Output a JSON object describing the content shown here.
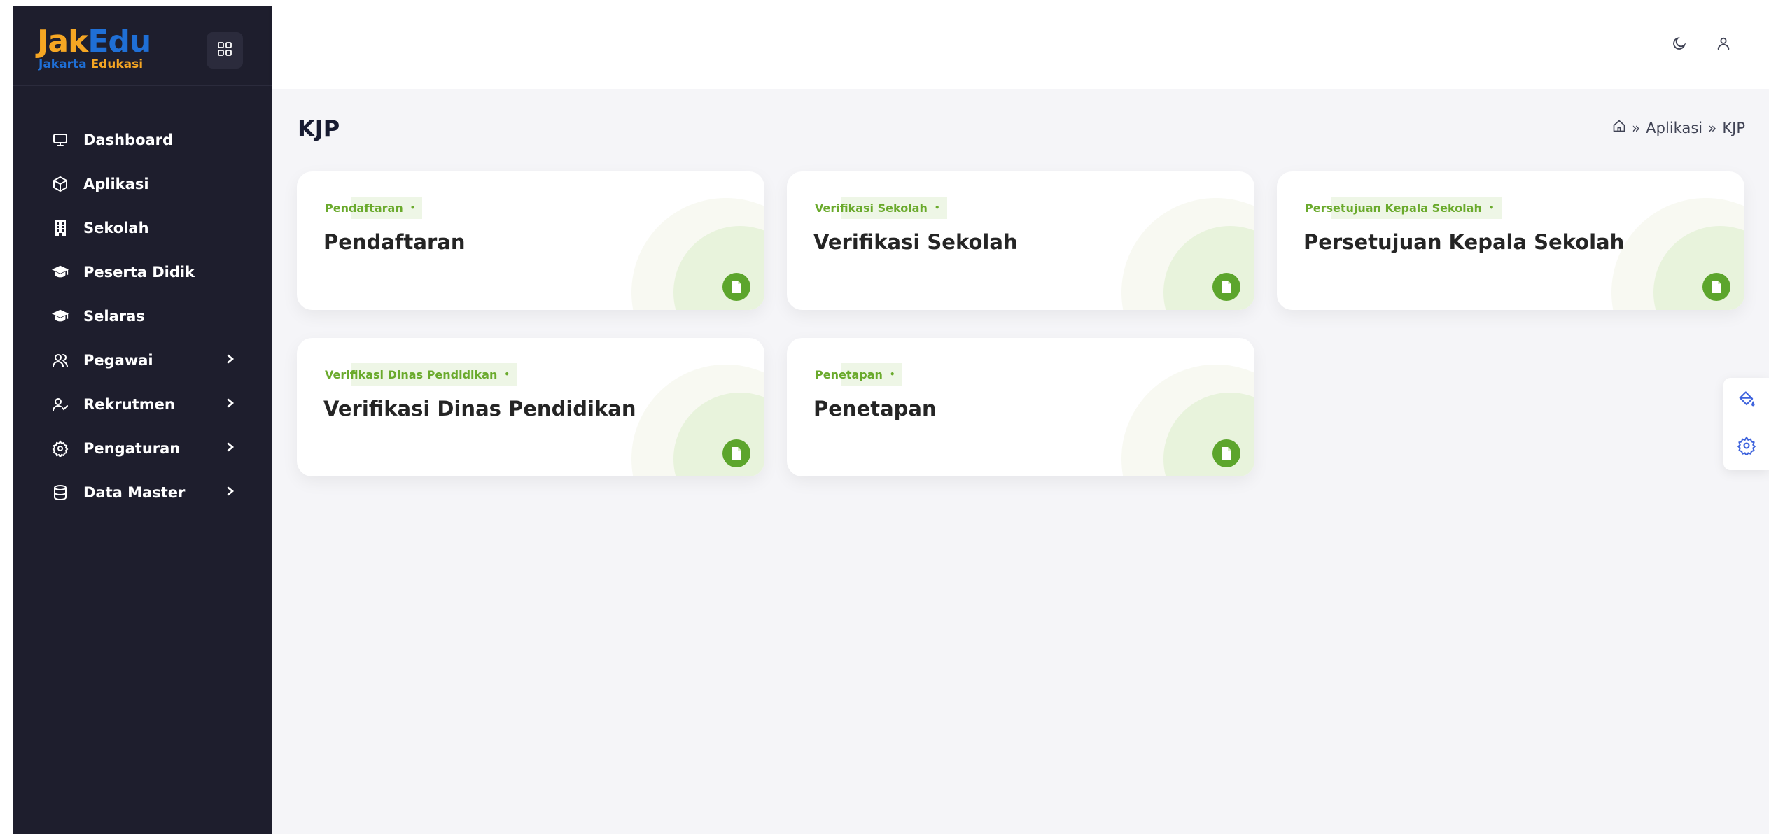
{
  "app": {
    "logo_text": "JakEdu",
    "logo_subtitle_a": "Jakarta",
    "logo_subtitle_b": "Edukasi"
  },
  "sidebar": {
    "items": [
      {
        "label": "Dashboard",
        "icon": "monitor-icon",
        "has_submenu": false
      },
      {
        "label": "Aplikasi",
        "icon": "cube-icon",
        "has_submenu": false
      },
      {
        "label": "Sekolah",
        "icon": "building-icon",
        "has_submenu": false
      },
      {
        "label": "Peserta Didik",
        "icon": "graduation-cap-icon",
        "has_submenu": false
      },
      {
        "label": "Selaras",
        "icon": "graduation-cap-icon",
        "has_submenu": false
      },
      {
        "label": "Pegawai",
        "icon": "users-icon",
        "has_submenu": true
      },
      {
        "label": "Rekrutmen",
        "icon": "user-check-icon",
        "has_submenu": true
      },
      {
        "label": "Pengaturan",
        "icon": "gear-icon",
        "has_submenu": true
      },
      {
        "label": "Data Master",
        "icon": "database-icon",
        "has_submenu": true
      }
    ]
  },
  "header": {
    "theme_toggle_icon": "moon-icon",
    "user_icon": "user-icon"
  },
  "main": {
    "title": "KJP",
    "breadcrumb": [
      "Aplikasi",
      "KJP"
    ],
    "cards": [
      {
        "tag": "Pendaftaran",
        "title": "Pendaftaran"
      },
      {
        "tag": "Verifikasi Sekolah",
        "title": "Verifikasi Sekolah"
      },
      {
        "tag": "Persetujuan Kepala Sekolah",
        "title": "Persetujuan Kepala Sekolah"
      },
      {
        "tag": "Verifikasi Dinas Pendidikan",
        "title": "Verifikasi Dinas Pendidikan"
      },
      {
        "tag": "Penetapan",
        "title": "Penetapan"
      }
    ]
  },
  "colors": {
    "sidebar_bg": "#1e1e2d",
    "accent_green": "#5ca52c",
    "accent_blue": "#3e63dd",
    "content_bg": "#f5f5f8"
  }
}
